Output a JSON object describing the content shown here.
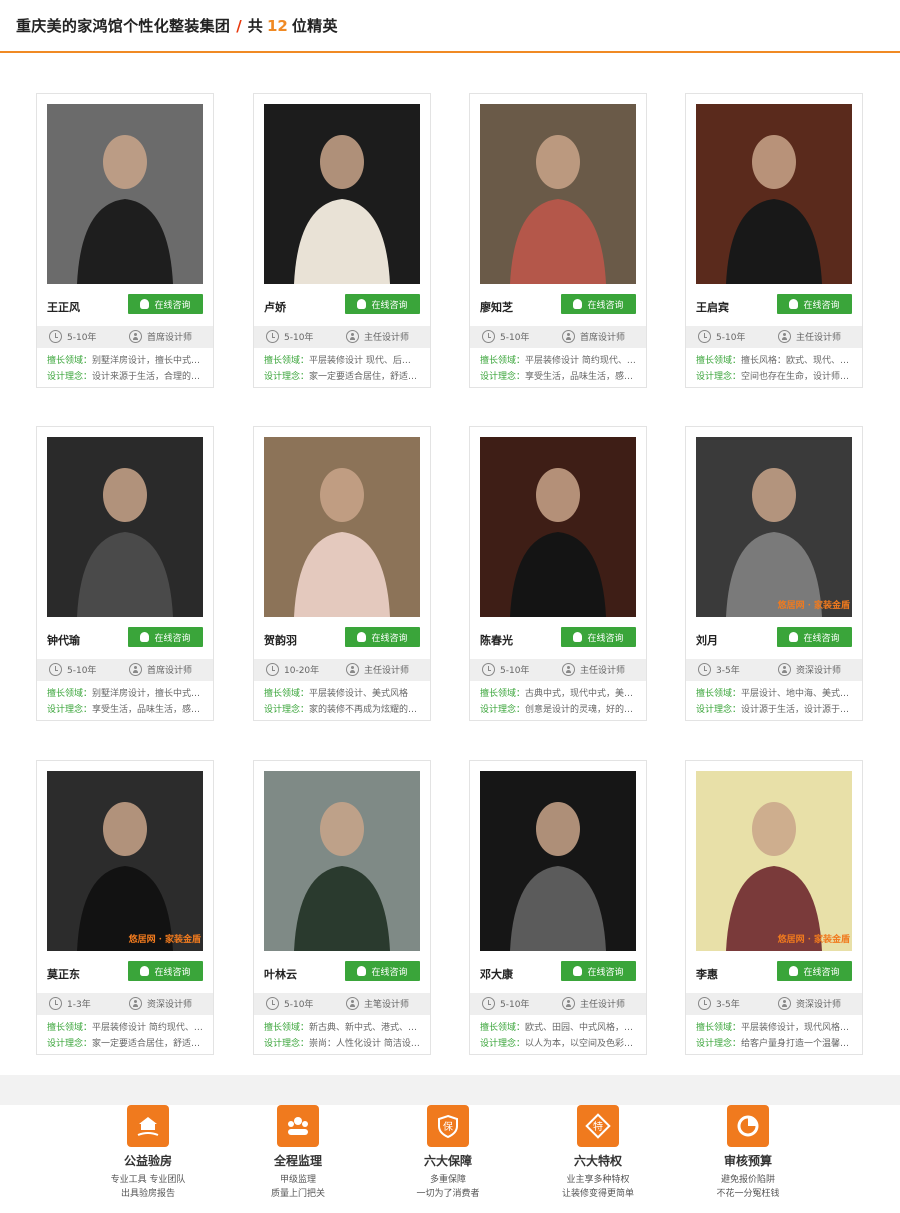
{
  "header": {
    "title": "重庆美的家鸿馆个性化整装集团",
    "slash": "/",
    "prefix": "共",
    "count": "12",
    "suffix": "位精英"
  },
  "consult_label": "在线咨询",
  "spec_label": "擅长领域：",
  "idea_label": "设计理念：",
  "watermark": "悠居网 · 家装金盾",
  "designers": [
    {
      "name": "王正风",
      "exp": "5-10年",
      "level": "首席设计师",
      "spec": "别墅洋房设计，擅长中式…",
      "idea": "设计来源于生活，合理的…",
      "bg": "#6b6b6b",
      "fg": "#1e1e1e",
      "wm": false
    },
    {
      "name": "卢娇",
      "exp": "5-10年",
      "level": "主任设计师",
      "spec": "平层装修设计 现代、后…",
      "idea": "家一定要适合居住，舒适…",
      "bg": "#1c1c1c",
      "fg": "#e9e2d6",
      "wm": false
    },
    {
      "name": "廖知芝",
      "exp": "5-10年",
      "level": "首席设计师",
      "spec": "平层装修设计 简约现代、…",
      "idea": "享受生活，品味生活，感…",
      "bg": "#6a5a48",
      "fg": "#b4574a",
      "wm": false
    },
    {
      "name": "王启宾",
      "exp": "5-10年",
      "level": "主任设计师",
      "spec": "擅长风格：欧式、现代、…",
      "idea": "空间也存在生命，设计师…",
      "bg": "#5a2a1c",
      "fg": "#181818",
      "wm": false
    },
    {
      "name": "钟代瑜",
      "exp": "5-10年",
      "level": "首席设计师",
      "spec": "别墅洋房设计，擅长中式…",
      "idea": "享受生活，品味生活，感…",
      "bg": "#2a2a2a",
      "fg": "#4a4a4a",
      "wm": false
    },
    {
      "name": "贺韵羽",
      "exp": "10-20年",
      "level": "主任设计师",
      "spec": "平层装修设计、美式风格",
      "idea": "家的装修不再成为炫耀的…",
      "bg": "#8c7358",
      "fg": "#e4c9be",
      "wm": false
    },
    {
      "name": "陈春光",
      "exp": "5-10年",
      "level": "主任设计师",
      "spec": "古典中式，现代中式，美…",
      "idea": "创意是设计的灵魂，好的…",
      "bg": "#3e1e16",
      "fg": "#141414",
      "wm": false
    },
    {
      "name": "刘月",
      "exp": "3-5年",
      "level": "资深设计师",
      "spec": "平层设计、地中海、美式…",
      "idea": "设计源于生活，设计源于…",
      "bg": "#3a3a3a",
      "fg": "#7a7a7a",
      "wm": true
    },
    {
      "name": "莫正东",
      "exp": "1-3年",
      "level": "资深设计师",
      "spec": "平层装修设计 简约现代、…",
      "idea": "家一定要适合居住，舒适…",
      "bg": "#2c2c2c",
      "fg": "#121212",
      "wm": true
    },
    {
      "name": "叶林云",
      "exp": "5-10年",
      "level": "主笔设计师",
      "spec": "新古典、新中式、港式、…",
      "idea": "崇尚：人性化设计 简洁设…",
      "bg": "#7f8a86",
      "fg": "#2a3a2e",
      "wm": false
    },
    {
      "name": "邓大康",
      "exp": "5-10年",
      "level": "主任设计师",
      "spec": "欧式、田园、中式风格，…",
      "idea": "以人为本，以空间及色彩…",
      "bg": "#161616",
      "fg": "#5b5b5b",
      "wm": false
    },
    {
      "name": "李惠",
      "exp": "3-5年",
      "level": "资深设计师",
      "spec": "平层装修设计，现代风格…",
      "idea": "给客户量身打造一个温馨…",
      "bg": "#e8e0a8",
      "fg": "#7a3a3a",
      "wm": true
    }
  ],
  "services": [
    {
      "icon": "house-hand-icon",
      "title": "公益验房",
      "line1": "专业工具  专业团队",
      "line2": "出具验房报告"
    },
    {
      "icon": "team-icon",
      "title": "全程监理",
      "line1": "甲级监理",
      "line2": "质量上门把关"
    },
    {
      "icon": "shield-icon",
      "title": "六大保障",
      "line1": "多重保障",
      "line2": "一切为了消费者"
    },
    {
      "icon": "privilege-icon",
      "title": "六大特权",
      "line1": "业主享多种特权",
      "line2": "让装修变得更简单"
    },
    {
      "icon": "pie-chart-icon",
      "title": "审核预算",
      "line1": "避免报价陷阱",
      "line2": "不花一分冤枉钱"
    }
  ]
}
